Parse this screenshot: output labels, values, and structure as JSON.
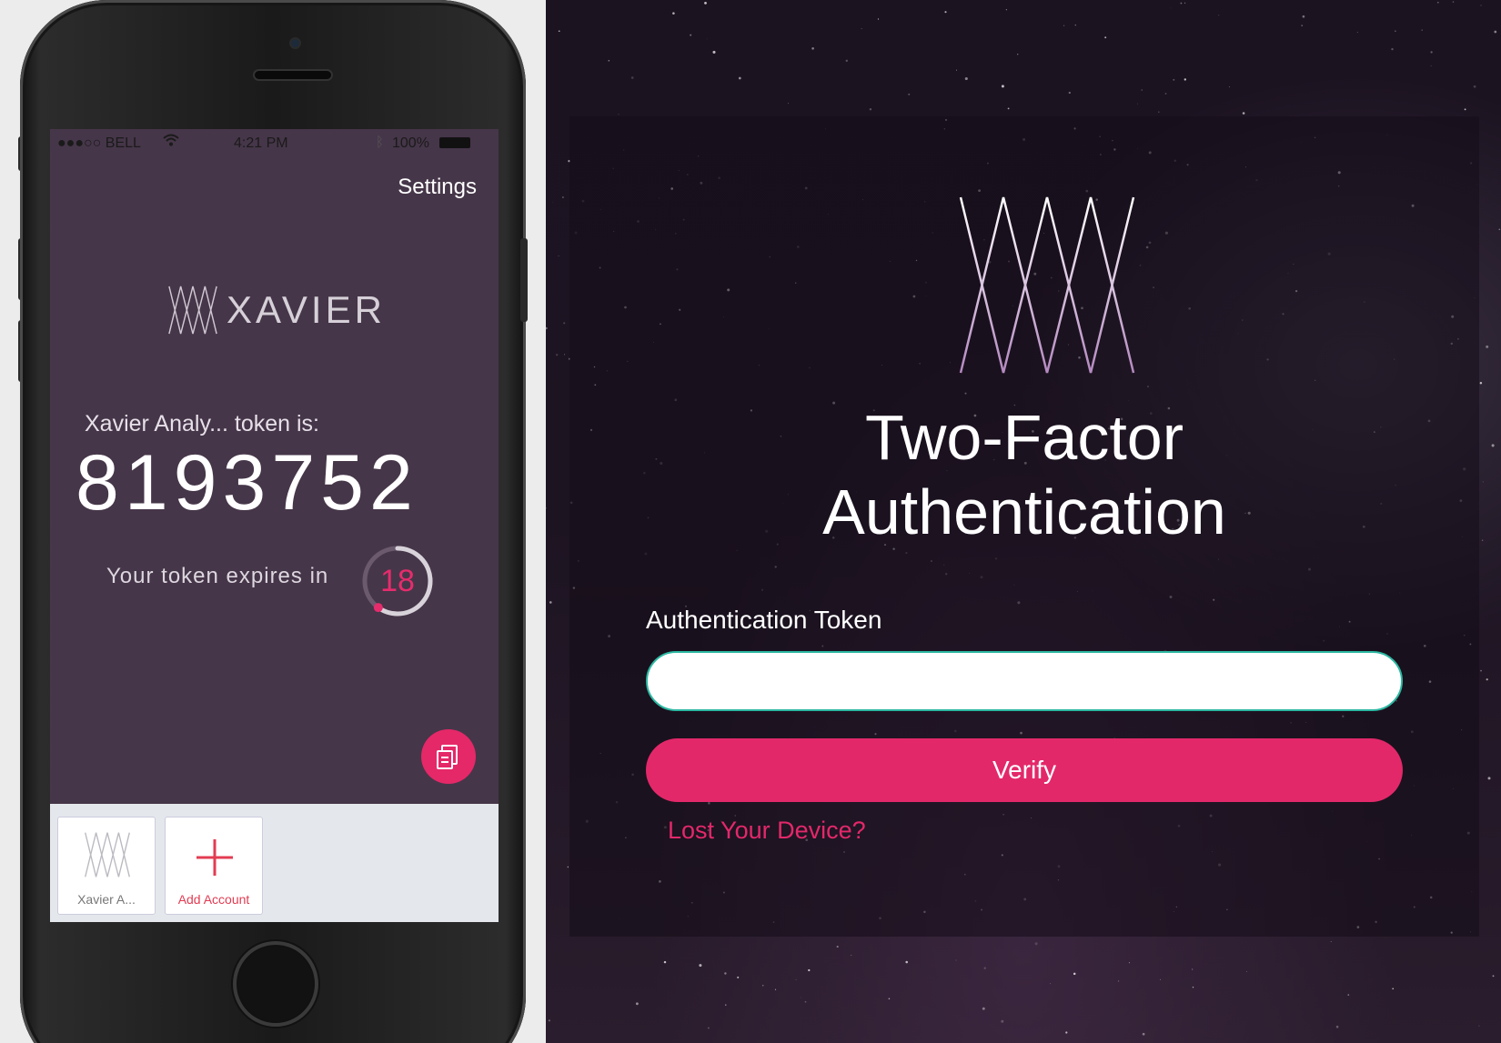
{
  "phone": {
    "status": {
      "carrier": "●●●○○ BELL",
      "time": "4:21 PM",
      "battery": "100%"
    },
    "settings_label": "Settings",
    "brand_name": "XAVIER",
    "token_label": "Xavier Analy... token is:",
    "token_value": "8193752",
    "expires_label": "Your token expires in",
    "timer_seconds": "18",
    "timer_fraction": 0.6,
    "tiles": [
      {
        "label": "Xavier A..."
      },
      {
        "label": "Add Account"
      }
    ]
  },
  "web": {
    "title_line1": "Two-Factor",
    "title_line2": "Authentication",
    "token_field_label": "Authentication Token",
    "token_field_value": "",
    "verify_label": "Verify",
    "lost_device_label": "Lost Your Device?"
  },
  "colors": {
    "accent": "#e3286a",
    "input_border": "#2cb8a2",
    "phone_screen": "#463649",
    "tray": "#e4e8ec"
  }
}
